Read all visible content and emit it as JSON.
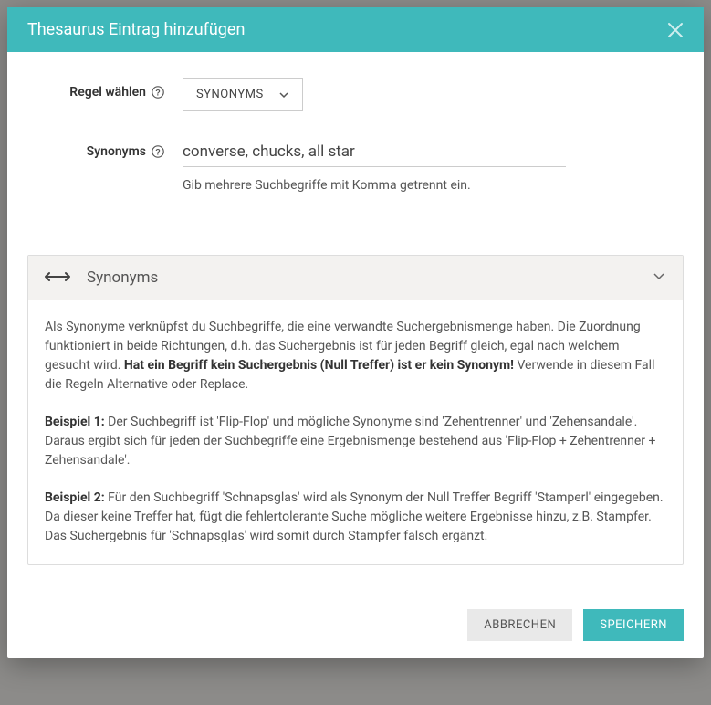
{
  "modal": {
    "title": "Thesaurus Eintrag hinzufügen",
    "form": {
      "rule_label": "Regel wählen",
      "rule_selected": "SYNONYMS",
      "synonyms_label": "Synonyms",
      "synonyms_value": "converse, chucks, all star",
      "synonyms_hint": "Gib mehrere Suchbegriffe mit Komma getrennt ein."
    },
    "info": {
      "title": "Synonyms",
      "p1_a": "Als Synonyme verknüpfst du Suchbegriffe, die eine verwandte Suchergebnismenge haben. Die Zuordnung funktioniert in beide Richtungen, d.h. das Suchergebnis ist für jeden Begriff gleich, egal nach welchem gesucht wird. ",
      "p1_bold": "Hat ein Begriff kein Suchergebnis (Null Treffer) ist er kein Synonym!",
      "p1_b": " Verwende in diesem Fall die Regeln Alternative oder Replace.",
      "p2_label": "Beispiel 1:",
      "p2_text": " Der Suchbegriff ist 'Flip-Flop' und mögliche Synonyme sind 'Zehentrenner' und 'Zehensandale'. Daraus ergibt sich für jeden der Suchbegriffe eine Ergebnismenge bestehend aus 'Flip-Flop + Zehentrenner + Zehensandale'.",
      "p3_label": "Beispiel 2:",
      "p3_text": " Für den Suchbegriff 'Schnapsglas' wird als Synonym der Null Treffer Begriff 'Stamperl' eingegeben. Da dieser keine Treffer hat, fügt die fehlertolerante Suche mögliche weitere Ergebnisse hinzu, z.B. Stampfer. Das Suchergebnis für 'Schnapsglas' wird somit durch Stampfer falsch ergänzt."
    },
    "footer": {
      "cancel": "ABBRECHEN",
      "save": "SPEICHERN"
    }
  }
}
